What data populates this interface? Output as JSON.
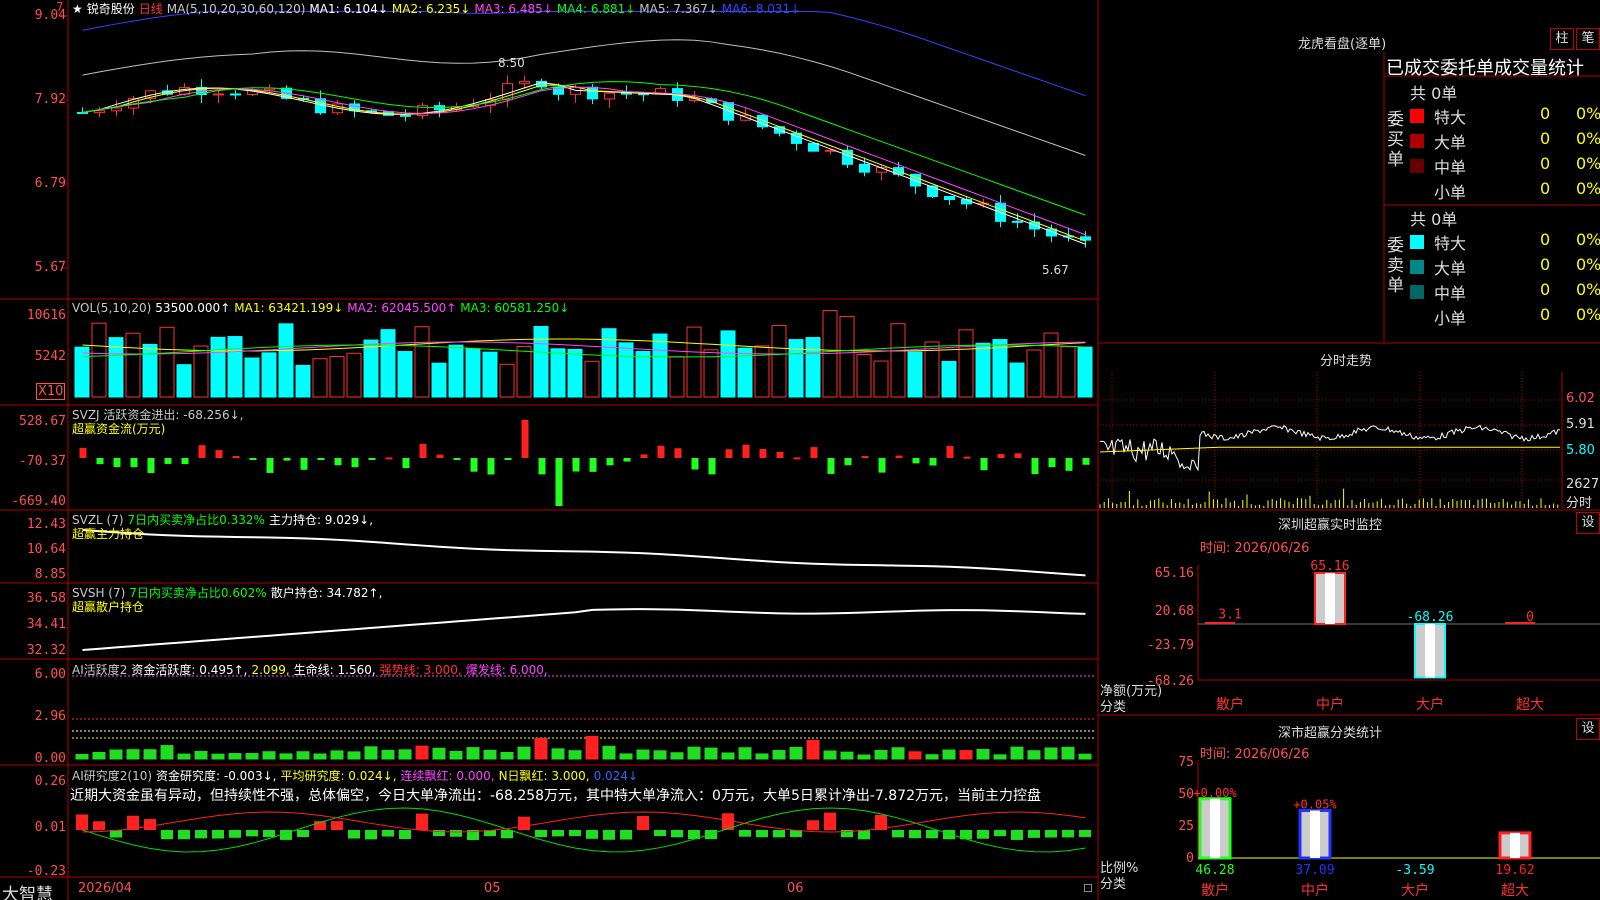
{
  "stock": {
    "star": "★",
    "name": "锐奇股份",
    "period": "日线",
    "ma_label": "MA(5,10,20,30,60,120)",
    "ma_values": [
      "MA1: 6.104↓",
      "MA2: 6.235↓",
      "MA3: 6.485↓",
      "MA4: 6.881↓",
      "MA5: 7.367↓",
      "MA6: 8.031↓"
    ],
    "ma_colors": [
      "#ffffff",
      "#ffff00",
      "#ff44ff",
      "#00ff00",
      "#c0c0c0",
      "#3344ff"
    ],
    "price_axis": [
      "9.04",
      "7.92",
      "6.79",
      "5.67"
    ],
    "high_label": "8.50",
    "low_label": "5.67",
    "corner": "7"
  },
  "vol": {
    "label": "VOL(5,10,20)",
    "value": "53500.000↑",
    "ma": [
      "MA1: 63421.199↓",
      "MA2: 62045.500↑",
      "MA3: 60581.250↓"
    ],
    "axis": [
      "10616",
      "5242"
    ],
    "unit": "X10"
  },
  "svzj": {
    "label": "SVZJ  活跃资金进出: -68.256↓,",
    "sub": "超赢资金流(万元)",
    "axis": [
      "528.67",
      "-70.37",
      "-669.40"
    ]
  },
  "svzl": {
    "label": "SVZL (7)",
    "pct": "7日内买卖净占比0.332%",
    "hold": "主力持仓: 9.029↓,",
    "sub": "超赢主力持仓",
    "axis": [
      "12.43",
      "10.64",
      "8.85"
    ]
  },
  "svsh": {
    "label": "SVSH (7)",
    "pct": "7日内买卖净占比0.602%",
    "hold": "散户持仓: 34.782↑,",
    "sub": "超赢散户持仓",
    "axis": [
      "36.58",
      "34.41",
      "32.32"
    ]
  },
  "ai1": {
    "a": "AI活跃度2",
    "b": "资金活跃度: 0.495↑,",
    "c": "2.099,",
    "d": "生命线: 1.560,",
    "e": "强势线: 3.000,",
    "f": "爆发线: 6.000,",
    "axis": [
      "6.00",
      "2.96",
      "0.00"
    ]
  },
  "ai2": {
    "a": "AI研究度2(10)",
    "b": "资金研究度: -0.003↓,",
    "c": "平均研究度: 0.024↓,",
    "d": "连续飘红: 0.000,",
    "e": "N日飘红: 3.000,",
    "f": "0.024↓",
    "comment": "近期大资金虽有异动，但持续性不强，总体偏空，今日大单净流出：-68.258万元，其中特大单净流入：0万元，大单5日累计净出-7.872万元，当前主力控盘",
    "axis": [
      "0.26",
      "0.01",
      "-0.23"
    ]
  },
  "dates": [
    "2026/04",
    "05",
    "06"
  ],
  "brand": "大智慧",
  "lhb": {
    "title": "龙虎看盘(逐单)",
    "btn1": "柱",
    "btn2": "笔",
    "tabs": "已成交委托单成交量统计",
    "buy_side": "委买单",
    "sell_side": "委卖单",
    "buy_total": "共 0单",
    "sell_total": "共 0单",
    "buy_rows": [
      {
        "label": "特大",
        "color": "#ff0000",
        "val": "0",
        "pct": "0%"
      },
      {
        "label": "大单",
        "color": "#aa0000",
        "val": "0",
        "pct": "0%"
      },
      {
        "label": "中单",
        "color": "#660000",
        "val": "0",
        "pct": "0%"
      },
      {
        "label": "小单",
        "color": "",
        "val": "0",
        "pct": "0%"
      }
    ],
    "sell_rows": [
      {
        "label": "特大",
        "color": "#00ffff",
        "val": "0",
        "pct": "0%"
      },
      {
        "label": "大单",
        "color": "#008888",
        "val": "0",
        "pct": "0%"
      },
      {
        "label": "中单",
        "color": "#006666",
        "val": "0",
        "pct": "0%"
      },
      {
        "label": "小单",
        "color": "",
        "val": "0",
        "pct": "0%"
      }
    ]
  },
  "fenshi": {
    "title": "分时走势",
    "axis": [
      "6.02",
      "5.91",
      "5.80"
    ],
    "vol": "2627",
    "unit": "分时"
  },
  "monitor": {
    "title": "深圳超赢实时监控",
    "btn": "设",
    "time": "时间: 2026/06/26",
    "axis": [
      "65.16",
      "20.68",
      "-23.79",
      "-68.26"
    ],
    "bars": [
      {
        "cat": "散户",
        "val": 3.1,
        "label": "3.1"
      },
      {
        "cat": "中户",
        "val": 65.16,
        "label": "65.16"
      },
      {
        "cat": "大户",
        "val": -68.26,
        "label": "-68.26"
      },
      {
        "cat": "超大",
        "val": 0,
        "label": "0"
      }
    ],
    "ylab": "净额(万元)",
    "xlab": "分类"
  },
  "classify": {
    "title": "深市超赢分类统计",
    "btn": "设",
    "time": "时间: 2026/06/26",
    "axis": [
      "75",
      "50",
      "25",
      "0"
    ],
    "bars": [
      {
        "cat": "散户",
        "val": 46.28,
        "top": "+0.00%"
      },
      {
        "cat": "中户",
        "val": 37.09,
        "top": "+0.05%"
      },
      {
        "cat": "大户",
        "val": -3.59,
        "top": ""
      },
      {
        "cat": "超大",
        "val": 19.62,
        "top": ""
      }
    ],
    "ylab": "比例%",
    "xlab": "分类"
  }
}
